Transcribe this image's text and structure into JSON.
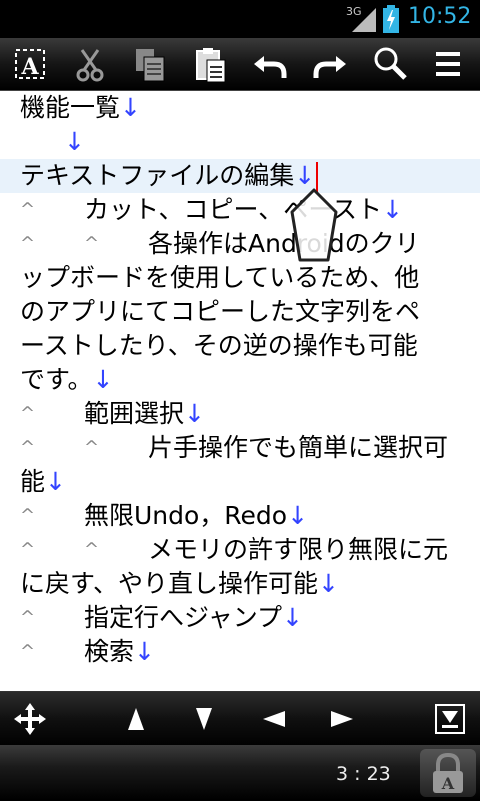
{
  "status_bar": {
    "network": "3G",
    "time": "10:52",
    "battery_color": "#33b5e5"
  },
  "toolbar": {
    "icons": [
      "text-select-icon",
      "cut-icon",
      "copy-icon",
      "paste-icon",
      "undo-icon",
      "redo-icon",
      "search-icon",
      "menu-icon"
    ]
  },
  "editor": {
    "newline_mark": "↓",
    "tab_mark": "^",
    "lines": [
      {
        "text": "機能一覧"
      },
      {
        "text": ""
      },
      {
        "text": "テキストファイルの編集"
      },
      {
        "text": "カット、コピー、ペースト"
      },
      {
        "text": "各操作はAndroidのクリ"
      },
      {
        "text": "ップボードを使用しているため、他"
      },
      {
        "text": "のアプリにてコピーした文字列をペ"
      },
      {
        "text": "ーストしたり、その逆の操作も可能"
      },
      {
        "text": "です。"
      },
      {
        "text": "範囲選択"
      },
      {
        "text": "片手操作でも簡単に選択可"
      },
      {
        "text": "能"
      },
      {
        "text": "無限Undo，Redo"
      },
      {
        "text": "メモリの許す限り無限に元"
      },
      {
        "text": "に戻す、やり直し操作可能"
      },
      {
        "text": "指定行へジャンプ"
      },
      {
        "text": "検索"
      }
    ],
    "caret_color": "#e00000",
    "current_line_bg": "#e8f2fb",
    "newline_color": "#3344ff"
  },
  "nav_bar": {
    "icons": [
      "move-cursor-icon",
      "up-arrow-icon",
      "down-arrow-icon",
      "left-arrow-icon",
      "right-arrow-icon",
      "page-end-icon"
    ]
  },
  "footer": {
    "position": "3 : 23",
    "lock_icon": "lock-icon"
  }
}
